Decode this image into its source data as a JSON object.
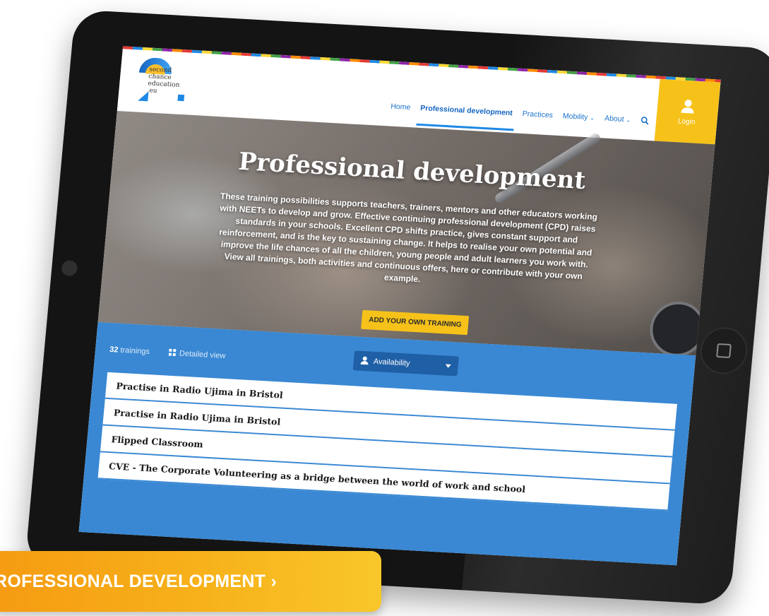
{
  "brand": {
    "logo_lines": [
      "second",
      "chance",
      "education",
      ".eu"
    ]
  },
  "nav": {
    "items": [
      {
        "label": "Home",
        "active": false,
        "dropdown": false
      },
      {
        "label": "Professional development",
        "active": true,
        "dropdown": false
      },
      {
        "label": "Practices",
        "active": false,
        "dropdown": false
      },
      {
        "label": "Mobility",
        "active": false,
        "dropdown": true
      },
      {
        "label": "About",
        "active": false,
        "dropdown": true
      }
    ],
    "search_icon": "search-icon",
    "login_label": "Login"
  },
  "hero": {
    "title": "Professional development",
    "text": "These training possibilities supports teachers, trainers, mentors and other educators working with NEETs to develop and grow. Effective continuing professional development (CPD) raises standards in your schools. Excellent CPD shifts practice, gives constant support and reinforcement, and is the key to sustaining change. It helps to realise your own potential and improve the life chances of all the children, young people and adult learners you work with. View all trainings, both activities and continuous offers, here or contribute with your own example.",
    "cta": "ADD YOUR OWN TRAINING"
  },
  "listing": {
    "count_number": "32",
    "count_label": "trainings",
    "detailed_view": "Detailed view",
    "filter_label": "Availability",
    "items": [
      "Practise in Radio Ujima in Bristol",
      "Practise in Radio Ujima in Bristol",
      "Flipped Classroom",
      "CVE - The Corporate Volunteering as a bridge between the world of work and school"
    ]
  },
  "cta_banner": {
    "label": "ROFESSIONAL DEVELOPMENT ›"
  },
  "colors": {
    "accent_yellow": "#f6c219",
    "primary_blue": "#3a88d3",
    "cta_orange": "#f59b12",
    "device": "#141414"
  }
}
